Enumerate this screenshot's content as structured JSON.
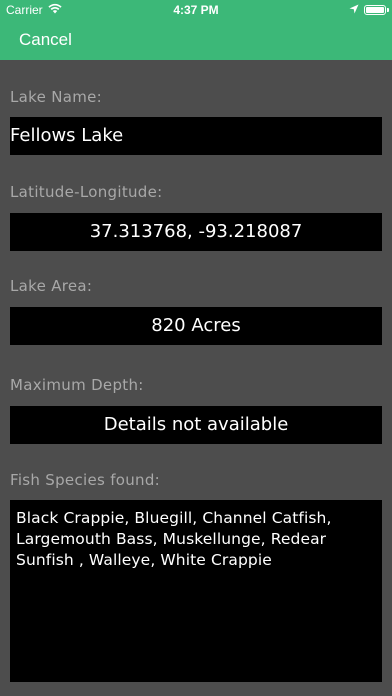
{
  "status_bar": {
    "carrier": "Carrier",
    "time": "4:37 PM",
    "battery_level": 1.0,
    "icons": [
      "wifi-icon",
      "location-arrow-icon",
      "battery-icon"
    ]
  },
  "nav": {
    "cancel_label": "Cancel"
  },
  "form": {
    "lake_name_label": "Lake Name:",
    "lake_name_value": "Fellows Lake",
    "latlong_label": "Latitude-Longitude:",
    "latlong_value": "37.313768, -93.218087",
    "area_label": "Lake Area:",
    "area_value": "820 Acres",
    "depth_label": "Maximum Depth:",
    "depth_value": "Details not available",
    "species_label": "Fish Species found:",
    "species_value": "Black Crappie, Bluegill, Channel Catfish, Largemouth Bass, Muskellunge, Redear Sunfish , Walleye, White Crappie"
  },
  "colors": {
    "header": "#3cb878",
    "background": "#4d4d4d",
    "field": "#000000",
    "label": "#a8a8a8"
  }
}
